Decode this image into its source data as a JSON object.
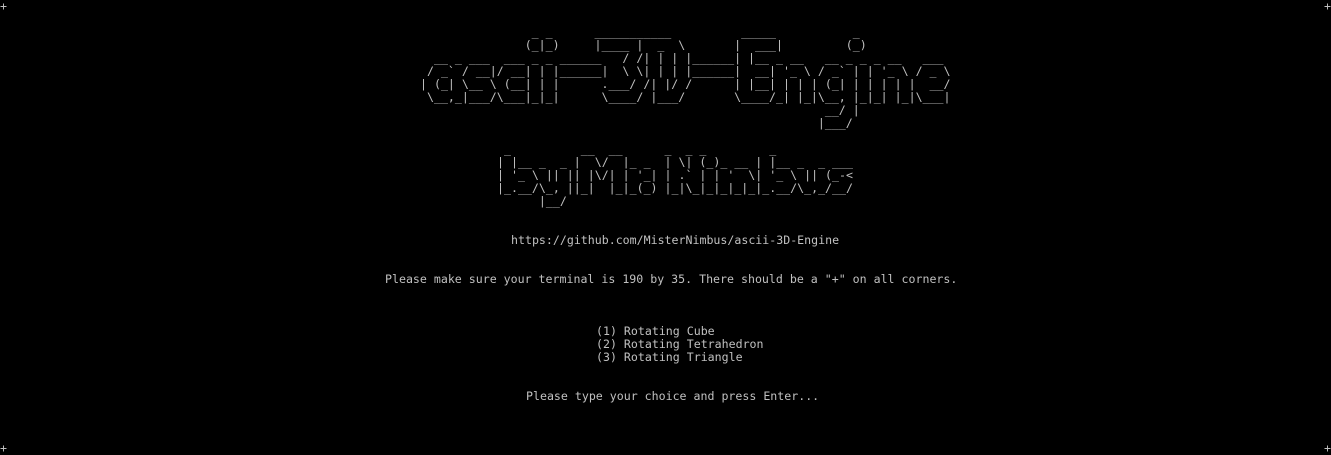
{
  "terminal": {
    "corner_marker": "+",
    "banner_title": [
      "                _ _      ___________          _____           _",
      "               (_|_)     |____ |  _  \\       |  ___|         (_)",
      "  __ _ ___  ___ _ _ ______   / /| | | |______| |__ _ __   __ _ _ _ __   ___",
      " / _` / __|/ __| | |______|  \\ \\| | | |______|  __| '_ \\ / _` | | '_ \\ / _ \\",
      "| (_| \\__ \\ (__| | |      .___/ /| |/ /      | |__| | | | (_| | | | | |  __/",
      " \\__,_|___/\\___|_|_|      \\____/ |___/       \\____/_| |_|\\__, |_|_| |_|\\___|",
      "                                                          __/ |",
      "                                                         |___/"
    ],
    "banner_author": [
      " _          __  __      _  _ _         _",
      "| |__ _  _ |  \\/  |_ _  | \\| (_)_ __ | |__ _  _ ___",
      "| '_ \\ || || |\\/| | '_| | .` | | '  \\| '_ \\ || (_-<",
      "|_.__/\\_, ||_|  |_|_(_) |_|\\_|_|_|_|_|_.__/\\_,_/__/",
      "      |__/"
    ],
    "url": "https://github.com/MisterNimbus/ascii-3D-Engine",
    "size_notice": "Please make sure your terminal is 190 by 35. There should be a \"+\" on all corners.",
    "menu": [
      "(1) Rotating Cube",
      "(2) Rotating Tetrahedron",
      "(3) Rotating Triangle"
    ],
    "prompt": "Please type your choice and press Enter..."
  }
}
